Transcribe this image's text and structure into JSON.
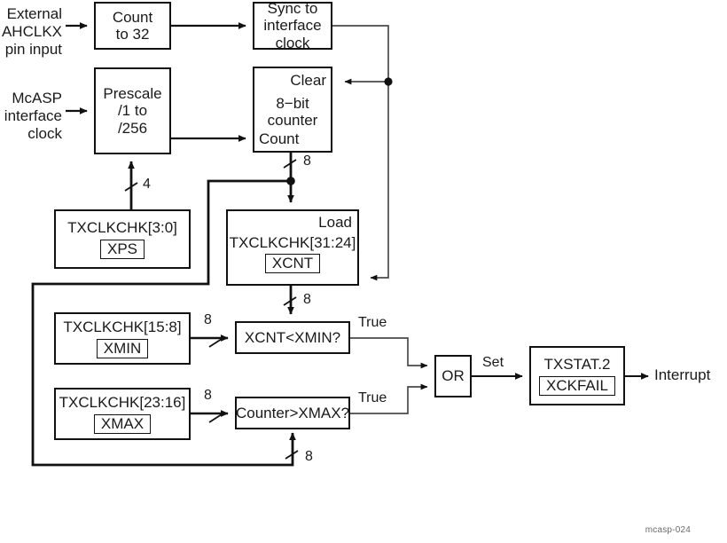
{
  "figure": {
    "id_label": "mcasp-024",
    "colors": {
      "ink": "#111111",
      "thin_wire": "#555555",
      "caption": "#6a6a6a",
      "background": "#ffffff"
    }
  },
  "inputs": [
    {
      "id": "external-ahclkx",
      "lines": [
        "External",
        "AHCLKX",
        "pin input"
      ]
    },
    {
      "id": "mcasp-interface-clock",
      "lines": [
        "McASP",
        "interface",
        "clock"
      ]
    }
  ],
  "blocks": {
    "count_to_32": {
      "lines": [
        "Count",
        "to 32"
      ]
    },
    "sync_to_interface_clock": {
      "lines": [
        "Sync to",
        "interface",
        "clock"
      ]
    },
    "prescale": {
      "lines": [
        "Prescale",
        "/1 to",
        "/256"
      ]
    },
    "counter8": {
      "clear_port": "Clear",
      "lines": [
        "8−bit",
        "counter"
      ],
      "count_port": "Count"
    },
    "xps_reg": {
      "field": "TXCLKCHK[3:0]",
      "name": "XPS"
    },
    "xcnt_reg": {
      "load_port": "Load",
      "field": "TXCLKCHK[31:24]",
      "name": "XCNT"
    },
    "xmin_reg": {
      "field": "TXCLKCHK[15:8]",
      "name": "XMIN"
    },
    "xmax_reg": {
      "field": "TXCLKCHK[23:16]",
      "name": "XMAX"
    },
    "cmp_xmin": {
      "label": "XCNT<XMIN?"
    },
    "cmp_xmax": {
      "label": "Counter>XMAX?"
    },
    "or_gate": {
      "label": "OR"
    },
    "txstat": {
      "field": "TXSTAT.2",
      "name": "XCKFAIL"
    }
  },
  "wire_labels": {
    "prescale_bus_width": "4",
    "counter_out_width": "8",
    "xcnt_out_width": "8",
    "xmin_bus_width": "8",
    "xmax_bus_width": "8",
    "counter_feedback_width": "8",
    "cmp_xmin_true": "True",
    "cmp_xmax_true": "True",
    "or_out": "Set",
    "final_out": "Interrupt"
  }
}
